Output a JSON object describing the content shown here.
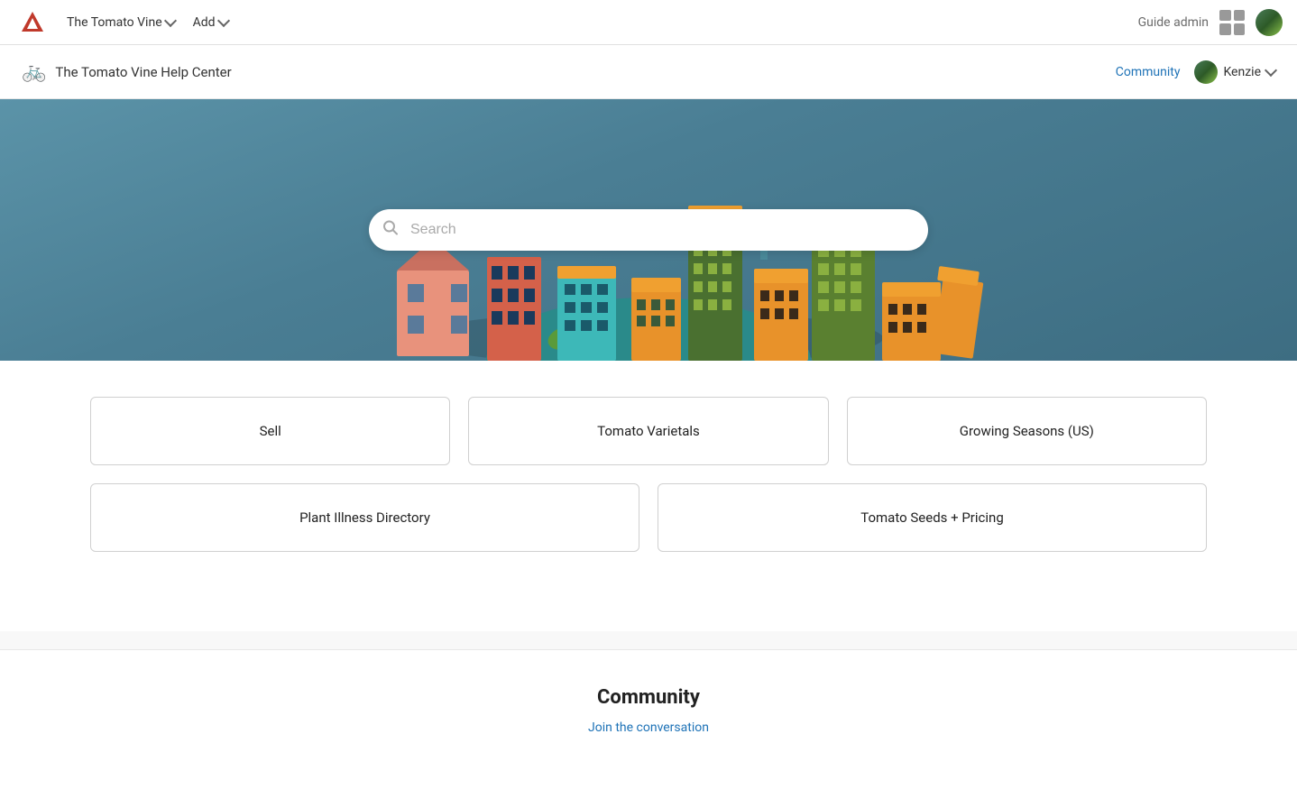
{
  "topNav": {
    "brand": "The Tomato Vine",
    "brandDropdown": true,
    "addLabel": "Add",
    "addDropdown": true,
    "guideAdminLabel": "Guide admin"
  },
  "subNav": {
    "helpCenterTitle": "The Tomato Vine Help Center",
    "communityLabel": "Community",
    "userName": "Kenzie",
    "userDropdown": true
  },
  "hero": {
    "searchPlaceholder": "Search"
  },
  "categories": {
    "row1": [
      {
        "label": "Sell"
      },
      {
        "label": "Tomato Varietals"
      },
      {
        "label": "Growing Seasons (US)"
      }
    ],
    "row2": [
      {
        "label": "Plant Illness Directory"
      },
      {
        "label": "Tomato Seeds + Pricing"
      }
    ]
  },
  "community": {
    "title": "Community",
    "joinLabel": "Join the conversation"
  }
}
